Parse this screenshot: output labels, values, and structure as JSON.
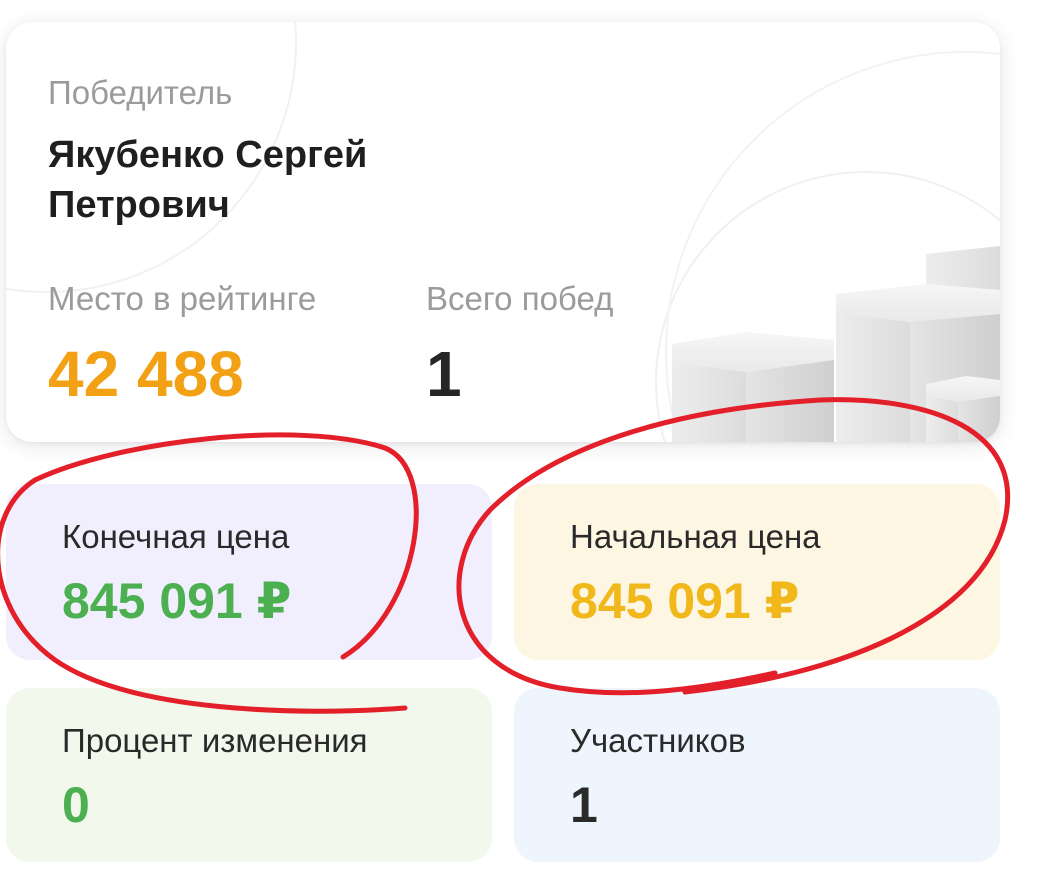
{
  "winner": {
    "label": "Победитель",
    "name": "Якубенко Сергей Петрович",
    "rating_label": "Место в рейтинге",
    "rating_value": "42 488",
    "wins_label": "Всего побед",
    "wins_value": "1"
  },
  "tiles": {
    "final_price": {
      "label": "Конечная цена",
      "value": "845 091 ₽"
    },
    "start_price": {
      "label": "Начальная цена",
      "value": "845 091 ₽"
    },
    "change_percent": {
      "label": "Процент изменения",
      "value": "0"
    },
    "participants": {
      "label": "Участников",
      "value": "1"
    }
  },
  "colors": {
    "rating_accent": "#f3a114",
    "final_price_green": "#4caf50",
    "start_price_yellow": "#f1b81b",
    "annotation_red": "#e3202a"
  }
}
